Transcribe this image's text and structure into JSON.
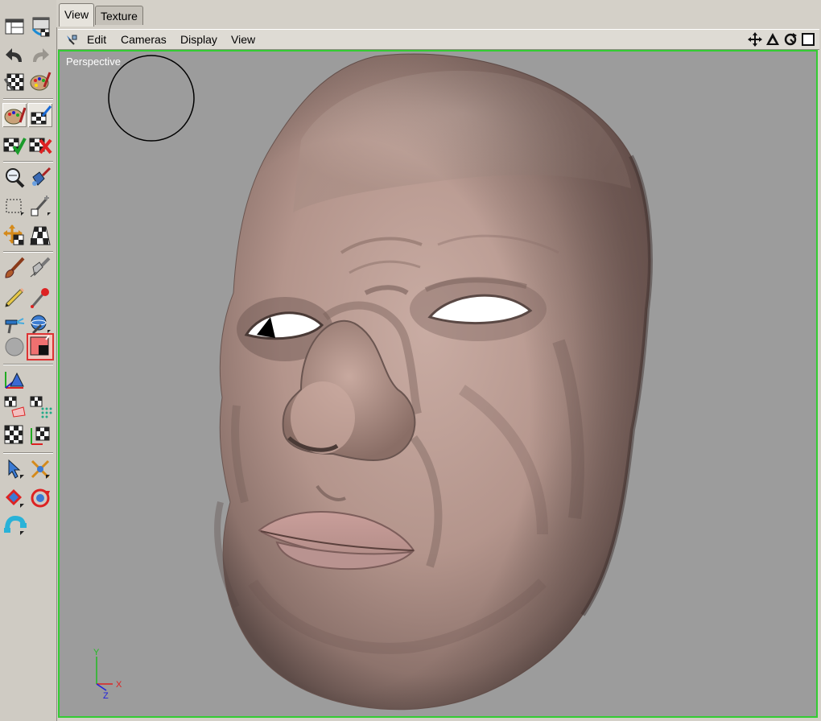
{
  "tabs": [
    {
      "label": "View",
      "active": true
    },
    {
      "label": "Texture",
      "active": false
    }
  ],
  "menu": {
    "edit": "Edit",
    "cameras": "Cameras",
    "display": "Display",
    "view": "View"
  },
  "viewport": {
    "label": "Perspective",
    "border_color": "#33cc33",
    "background": "#9c9c9c"
  },
  "axis": {
    "y": "Y",
    "z": "Z",
    "x": "X"
  },
  "toolbar_icons": [
    "layout-icon",
    "texture-layout-icon",
    "undo-icon",
    "redo-icon",
    "render-checker-icon",
    "paint-palette-icon",
    "paint-brush-palette-icon",
    "brush-checker-icon",
    "checker-apply-icon",
    "checker-remove-icon",
    "magnify-icon",
    "brush-bucket-icon",
    "selection-rect-icon",
    "wand-icon",
    "move-checker-icon",
    "checker-grid-icon",
    "brush-icon",
    "smudge-icon",
    "pencil-icon",
    "eyedropper-icon",
    "airbrush-icon",
    "sphere-tool-icon",
    "gray-swatch-icon",
    "color-swatch-icon",
    "axis-object-icon",
    "checker-uv-icon",
    "checker-dots-icon",
    "checker-icon",
    "checker-axis-icon",
    "pointer-icon",
    "scale-points-icon",
    "move-arrows-icon",
    "rotate-icon",
    "magnet-icon"
  ],
  "viewport_controls": [
    "move-view-icon",
    "scale-view-icon",
    "rotate-view-icon",
    "maximize-view-icon"
  ],
  "colors": {
    "toolbar_bg": "#cfcbc3",
    "accent_red": "#dd3333",
    "skin": "#b89a91"
  }
}
